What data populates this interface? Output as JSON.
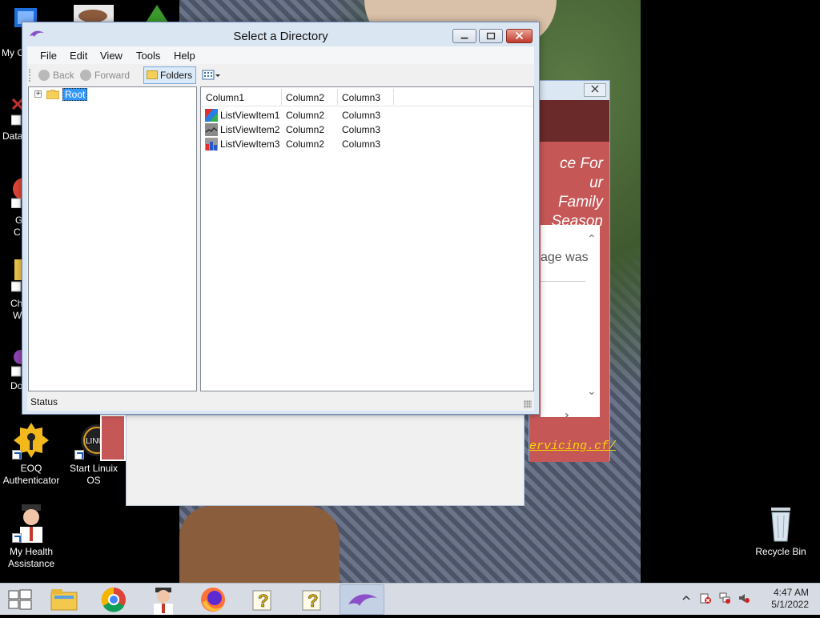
{
  "desktop": {
    "icons": [
      {
        "label": "EOQ Authenticator"
      },
      {
        "label": "Start Linuix OS"
      },
      {
        "label": "My Health Assistance"
      },
      {
        "label": "Recycle Bin"
      }
    ],
    "clipped_labels": [
      "My C",
      "Data",
      "G",
      "C",
      "Ch",
      "W",
      "Do"
    ]
  },
  "background_window": {
    "tagline": [
      "ce For",
      "ur Family",
      "Season"
    ],
    "panel_text": "age was",
    "link_text": "ervicing.cf/"
  },
  "dialog": {
    "title": "Select a Directory",
    "menu": [
      "File",
      "Edit",
      "View",
      "Tools",
      "Help"
    ],
    "toolbar": {
      "back": "Back",
      "forward": "Forward",
      "folders": "Folders"
    },
    "tree": {
      "root": "Root"
    },
    "list": {
      "columns": [
        "Column1",
        "Column2",
        "Column3"
      ],
      "rows": [
        {
          "name": "ListViewItem1",
          "c2": "Column2",
          "c3": "Column3"
        },
        {
          "name": "ListViewItem2",
          "c2": "Column2",
          "c3": "Column3"
        },
        {
          "name": "ListViewItem3",
          "c2": "Column2",
          "c3": "Column3"
        }
      ]
    },
    "status": "Status"
  },
  "taskbar": {
    "clock": {
      "time": "4:47 AM",
      "date": "5/1/2022"
    }
  }
}
